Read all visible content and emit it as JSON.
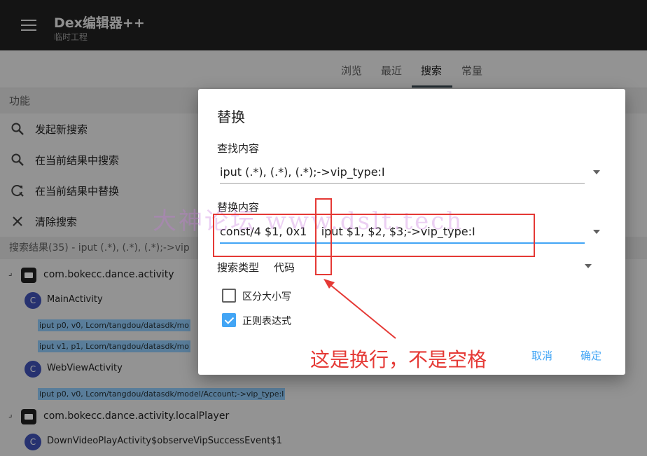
{
  "app": {
    "title": "Dex编辑器++",
    "subtitle": "临时工程"
  },
  "tabs": [
    {
      "label": "浏览"
    },
    {
      "label": "最近"
    },
    {
      "label": "搜索"
    },
    {
      "label": "常量"
    }
  ],
  "function_section": {
    "header": "功能",
    "items": [
      {
        "icon": "search-icon",
        "label": "发起新搜索"
      },
      {
        "icon": "search-icon",
        "label": "在当前结果中搜索"
      },
      {
        "icon": "replace-icon",
        "label": "在当前结果中替换"
      },
      {
        "icon": "close-icon",
        "label": "清除搜索"
      }
    ]
  },
  "results": {
    "header": "搜索结果(35) - iput (.*), (.*), (.*);->vip",
    "pkg1": "com.bokecc.dance.activity",
    "class1": "MainActivity",
    "code1": "iput p0, v0, Lcom/tangdou/datasdk/mo",
    "code2": "iput v1, p1, Lcom/tangdou/datasdk/mo",
    "class2": "WebViewActivity",
    "code3": "iput p0, v0, Lcom/tangdou/datasdk/model/Account;->vip_type:I",
    "pkg2": "com.bokecc.dance.activity.localPlayer",
    "class3": "DownVideoPlayActivity$observeVipSuccessEvent$1",
    "class_icon_letter": "C"
  },
  "dialog": {
    "title": "替换",
    "find_label": "查找内容",
    "find_value": "iput (.*), (.*), (.*);->vip_type:I",
    "replace_label": "替换内容",
    "replace_value": "const/4 $1, 0x1    iput $1, $2, $3;->vip_type:I",
    "search_type_label": "搜索类型",
    "search_type_value": "代码",
    "case_label": "区分大小写",
    "regex_label": "正则表达式",
    "cancel": "取消",
    "ok": "确定"
  },
  "annotation": {
    "text": "这是换行，不是空格"
  },
  "watermark": {
    "text": "大神论坛  www.dslt.tech"
  },
  "colors": {
    "appbar": "#212121",
    "accent": "#42a5f5",
    "annotation": "#e53935"
  }
}
